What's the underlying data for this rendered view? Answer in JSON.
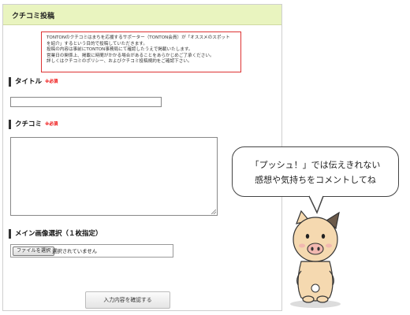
{
  "panel": {
    "header_title": "クチコミ投稿"
  },
  "notice": {
    "lines": [
      "TONTONのクチコミはまちを応援するサポーター（TONTON会員）が「オススメのスポット",
      "を紹介」するという目的で投稿していただきます。",
      "投稿の内容は事前にTONTON事務局にて確認したうえで掲載いたします。",
      "営業日の関係上、掲載に時間がかかる場合があることをあらかじめご了承ください。",
      "詳しくはクチコミのポリシー、およびクチコミ投稿規約をご確認下さい。"
    ]
  },
  "form": {
    "title_label": "タイトル",
    "title_required": "※必須",
    "title_value": "",
    "review_label": "クチコミ",
    "review_required": "※必須",
    "review_value": "",
    "image_label": "メイン画像選択（１枚指定）",
    "file_button_label": "ファイルを選択",
    "file_status": "選択されていません",
    "confirm_button_label": "入力内容を確認する"
  },
  "bubble": {
    "line1": "「プッシュ！」では伝えきれない",
    "line2": "感想や気持ちをコメントしてね"
  },
  "colors": {
    "header_bg": "#e9f4bf",
    "notice_border": "#dd3333",
    "required": "#ee0000",
    "pig_body": "#f5d9b0",
    "pig_pink": "#f2b8b0"
  },
  "icons": {
    "mascot": "pig-mascot-icon"
  }
}
